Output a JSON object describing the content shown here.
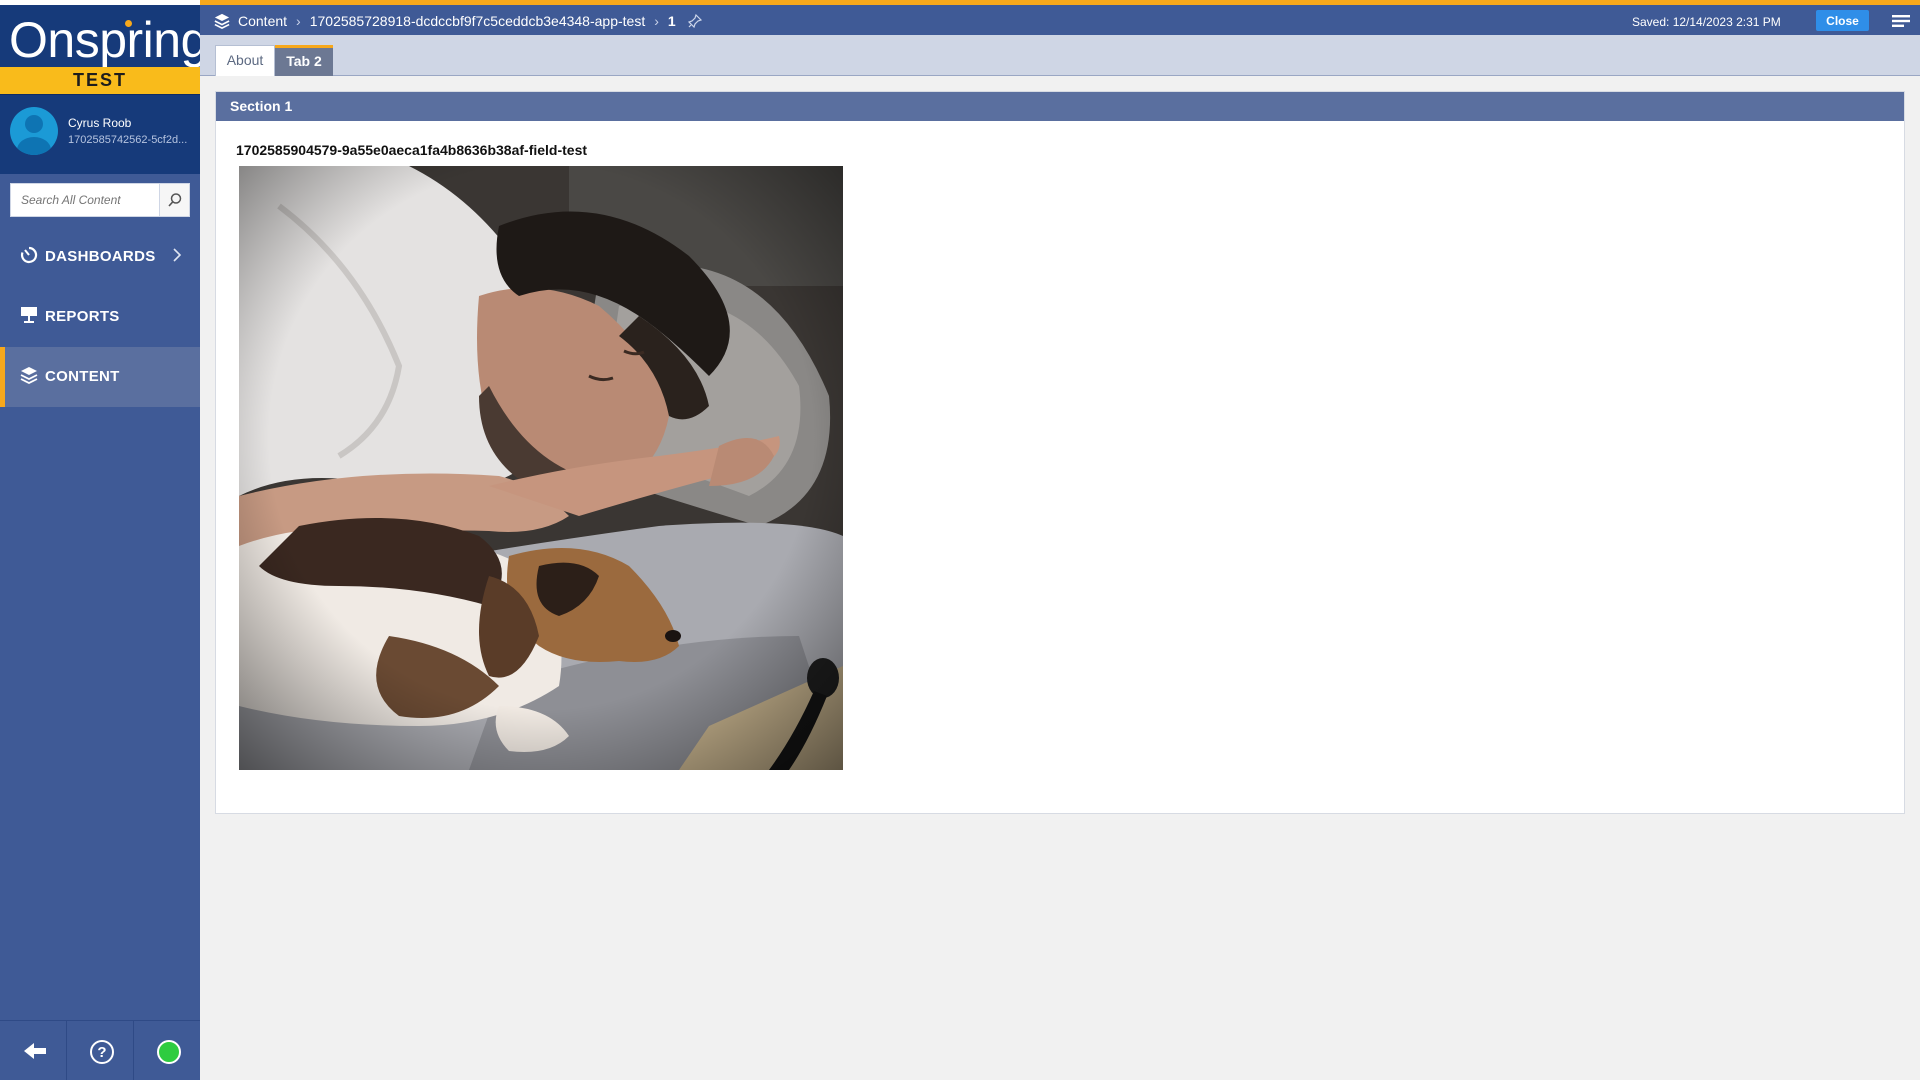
{
  "brand": {
    "name": "Onspring",
    "env": "TEST"
  },
  "user": {
    "name": "Cyrus Roob",
    "id": "1702585742562-5cf2d..."
  },
  "search": {
    "placeholder": "Search All Content"
  },
  "nav": {
    "items": [
      {
        "label": "DASHBOARDS",
        "icon": "dashboard-icon"
      },
      {
        "label": "REPORTS",
        "icon": "report-icon"
      },
      {
        "label": "CONTENT",
        "icon": "layers-icon"
      }
    ]
  },
  "topbar": {
    "breadcrumb": [
      "Content",
      "1702585728918-dcdccbf9f7c5ceddcb3e4348-app-test",
      "1"
    ],
    "saved": "Saved: 12/14/2023 2:31 PM",
    "close_label": "Close"
  },
  "tabs": [
    {
      "label": "About"
    },
    {
      "label": "Tab 2"
    }
  ],
  "section": {
    "title": "Section 1",
    "field_label": "1702585904579-9a55e0aeca1fa4b8636b38af-field-test"
  },
  "colors": {
    "accent": "#f7a81b",
    "sidebar": "#3f5a96",
    "brand_dark": "#163a7a",
    "close_button": "#2f8ee8",
    "status": "#2ecc40"
  }
}
